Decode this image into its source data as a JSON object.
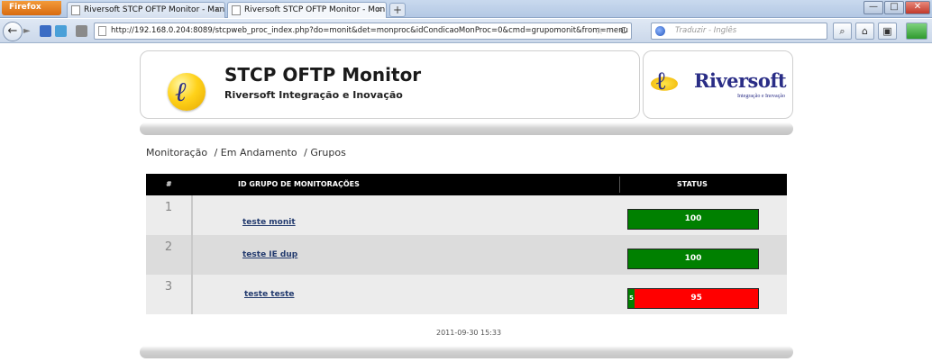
{
  "browser": {
    "firefox_label": "Firefox",
    "tabs": [
      {
        "title": "Riversoft STCP OFTP Monitor - Manu...",
        "active": false
      },
      {
        "title": "Riversoft STCP OFTP Monitor - Monit...",
        "active": true
      }
    ],
    "new_tab": "+",
    "url": "http://192.168.0.204:8089/stcpweb_proc_index.php?do=monit&det=monproc&idCondicaoMonProc=0&cmd=grupomonit&from=menu",
    "search_placeholder": "Traduzir - Inglês",
    "window_controls": {
      "minimize": "—",
      "maximize": "□",
      "close": "✕"
    },
    "icons": {
      "back": "←",
      "forward": "►",
      "star": "☆",
      "reload": "C",
      "search": "⌕",
      "home": "⌂",
      "menu": "▣",
      "tab_close": "×"
    }
  },
  "header": {
    "app_title": "STCP OFTP Monitor",
    "app_subtitle": "Riversoft Integração e Inovação",
    "brand_name": "Riversoft",
    "brand_tagline": "Integração e Inovação"
  },
  "breadcrumb": [
    "Monitoração",
    "/ Em Andamento",
    "/ Grupos"
  ],
  "table": {
    "columns": [
      "#",
      "ID GRUPO DE MONITORAÇÕES",
      "STATUS"
    ],
    "rows": [
      {
        "num": "1",
        "name": "teste monit",
        "ok": 100,
        "ok_label": "",
        "bad": 0,
        "bad_label": "",
        "total_label": "100"
      },
      {
        "num": "2",
        "name": "teste IE dup",
        "ok": 100,
        "ok_label": "",
        "bad": 0,
        "bad_label": "",
        "total_label": "100"
      },
      {
        "num": "3",
        "name": "teste teste",
        "ok": 5,
        "ok_label": "5",
        "bad": 95,
        "bad_label": "95",
        "total_label": ""
      }
    ]
  },
  "timestamp": "2011-09-30 15:33",
  "colors": {
    "ok": "#008000",
    "bad": "#ff0000",
    "link": "#223a6e",
    "brand": "#2a2d86"
  }
}
